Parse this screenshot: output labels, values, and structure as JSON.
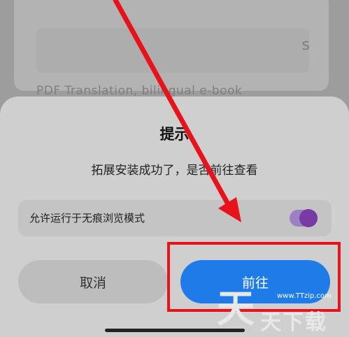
{
  "background": {
    "trailing_text": "s",
    "subtitle": "PDF Translation, bilingual e-book"
  },
  "dialog": {
    "title": "提示",
    "message": "拓展安装成功了，是否前往查看",
    "option_label": "允许运行于无痕浏览模式",
    "option_enabled": true,
    "cancel_label": "取消",
    "confirm_label": "前往"
  },
  "watermark": {
    "url": "www.TTzip.com",
    "big": "天",
    "small": "天下载"
  },
  "colors": {
    "confirm": "#1f7be8",
    "toggle": "#7a3aa6",
    "annotation": "#e8131a"
  }
}
